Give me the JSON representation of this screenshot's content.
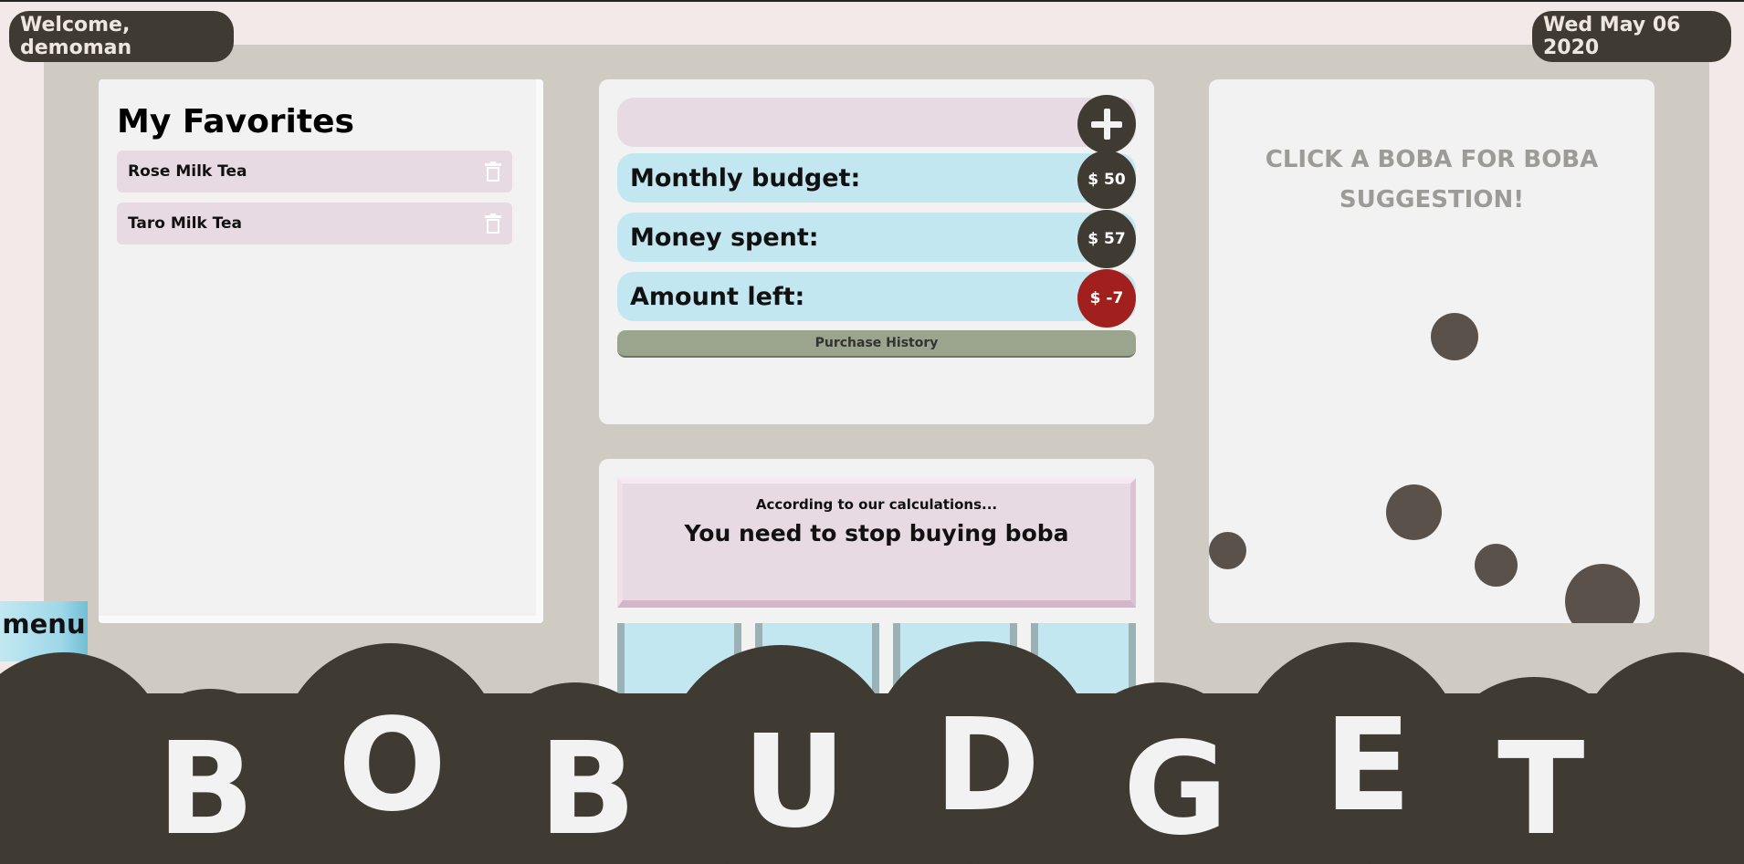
{
  "header": {
    "welcome": "Welcome, demoman",
    "date": "Wed May 06 2020"
  },
  "favorites": {
    "title": "My Favorites",
    "items": [
      {
        "label": "Rose Milk Tea",
        "icon": "trash-icon"
      },
      {
        "label": "Taro Milk Tea",
        "icon": "trash-icon"
      }
    ]
  },
  "budget": {
    "add_icon": "plus-icon",
    "rows": [
      {
        "label": "Monthly budget:",
        "value": "$ 50"
      },
      {
        "label": "Money spent:",
        "value": "$ 57"
      },
      {
        "label": "Amount left:",
        "value": "$ -7"
      }
    ],
    "history_label": "Purchase History",
    "colors": {
      "bar_blue": "#c2e7f1",
      "bar_pink": "#e8dae3",
      "circle": "#3f3a32",
      "negative": "#a1201e"
    }
  },
  "advice": {
    "intro": "According to our calculations...",
    "message": "You need to stop buying boba"
  },
  "boba": {
    "prompt": "CLICK A BOBA FOR BOBA SUGGESTION!"
  },
  "menu": {
    "label": "menu"
  },
  "footer": {
    "letters": [
      "B",
      "O",
      "B",
      "U",
      "D",
      "G",
      "E",
      "T"
    ],
    "color": "#3f3a32"
  }
}
